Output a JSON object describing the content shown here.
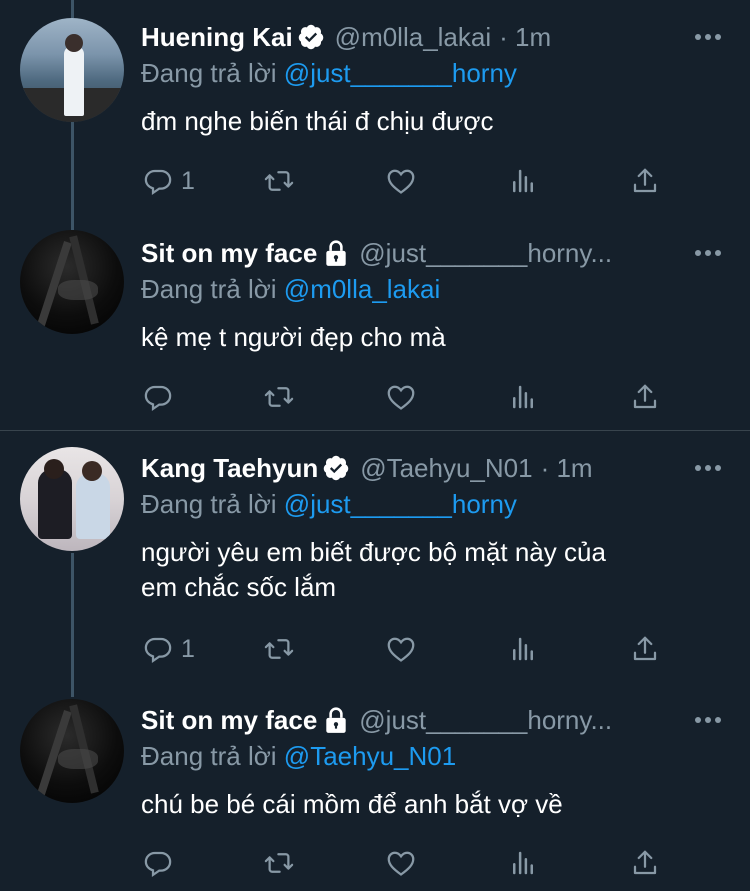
{
  "tweets": [
    {
      "name": "Huening Kai",
      "verified": true,
      "locked": false,
      "handle": "@m0lla_lakai",
      "time": "· 1m",
      "reply_prefix": "Đang trả lời",
      "reply_to": "@just_______horny",
      "lines": [
        "đm nghe biến thái đ chịu được"
      ],
      "reply_count": "1",
      "avatar": "ocean"
    },
    {
      "name": "Sit on my face",
      "verified": false,
      "locked": true,
      "handle": "@just_______horny...",
      "time": "",
      "reply_prefix": "Đang trả lời",
      "reply_to": "@m0lla_lakai",
      "lines": [
        "kệ mẹ t người đẹp cho mà"
      ],
      "reply_count": "",
      "avatar": "dark"
    },
    {
      "name": "Kang Taehyun",
      "verified": true,
      "locked": false,
      "handle": "@Taehyu_N01",
      "time": "· 1m",
      "reply_prefix": "Đang trả lời",
      "reply_to": "@just_______horny",
      "lines": [
        "người yêu em biết được bộ mặt này của",
        "em chắc sốc lắm"
      ],
      "reply_count": "1",
      "avatar": "couple"
    },
    {
      "name": "Sit on my face",
      "verified": false,
      "locked": true,
      "handle": "@just_______horny...",
      "time": "",
      "reply_prefix": "Đang trả lời",
      "reply_to": "@Taehyu_N01",
      "lines": [
        "chú be bé cái mồm để anh bắt vợ về"
      ],
      "reply_count": "",
      "avatar": "dark"
    }
  ],
  "icons": {
    "reply": "reply-icon",
    "retweet": "retweet-icon",
    "like": "heart-icon",
    "analytics": "analytics-icon",
    "share": "share-icon",
    "more": "more-icon",
    "verified": "verified-icon",
    "lock": "lock-icon"
  },
  "colors": {
    "background": "#15202b",
    "secondary_text": "#8899a6",
    "mention": "#1d9bf0",
    "thread_line": "#3d5466"
  }
}
